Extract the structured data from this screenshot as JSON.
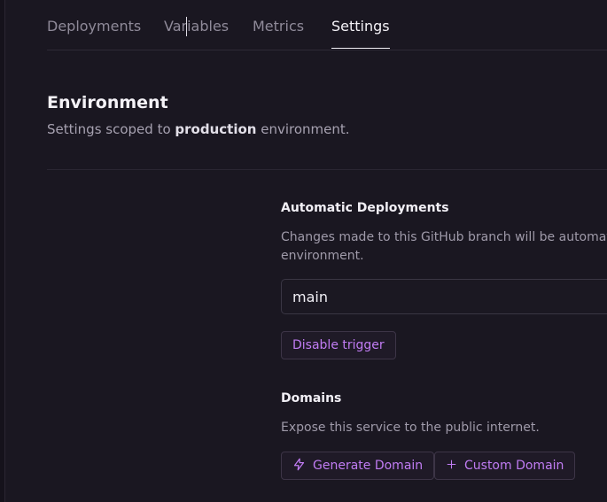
{
  "tabs": [
    {
      "label": "Deployments",
      "active": false
    },
    {
      "label": "Variables",
      "active": false
    },
    {
      "label": "Metrics",
      "active": false
    },
    {
      "label": "Settings",
      "active": true
    }
  ],
  "environment": {
    "title": "Environment",
    "subtitle_prefix": "Settings scoped to ",
    "subtitle_bold": "production",
    "subtitle_suffix": " environment."
  },
  "auto_deploy": {
    "title": "Automatic Deployments",
    "description_line1": "Changes made to this GitHub branch will be automatica",
    "description_line2": "environment.",
    "branch_value": "main",
    "disable_button": "Disable trigger"
  },
  "domains": {
    "title": "Domains",
    "description": "Expose this service to the public internet.",
    "generate_button": "Generate Domain",
    "custom_button": "+ Custom Domain",
    "custom_button_label": "Custom Domain"
  },
  "colors": {
    "background": "#1a1721",
    "accent": "#c07cf3",
    "text_primary": "#f4f2f7",
    "text_muted": "#8f8a99"
  },
  "icons": {
    "generate": "lightning-bolt-icon",
    "custom": "plus-icon"
  }
}
